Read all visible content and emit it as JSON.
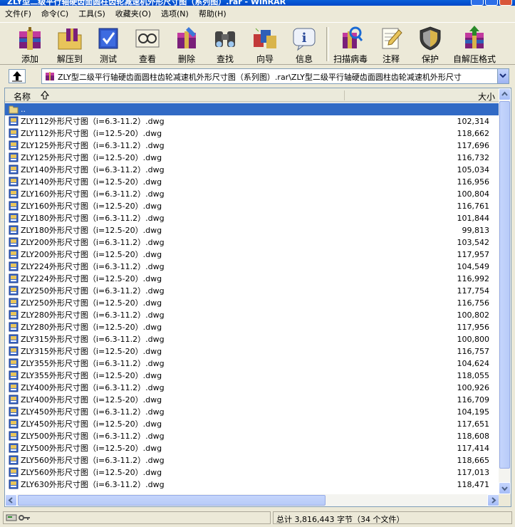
{
  "window": {
    "title": "ZLY型二级平行轴硬齿面圆柱齿轮减速机外形尺寸图（系列图）.rar - WinRAR"
  },
  "menu": [
    "文件(F)",
    "命令(C)",
    "工具(S)",
    "收藏夹(O)",
    "选项(N)",
    "帮助(H)"
  ],
  "toolbar": [
    {
      "label": "添加",
      "icon": "add-archive-icon"
    },
    {
      "label": "解压到",
      "icon": "extract-to-icon"
    },
    {
      "label": "测试",
      "icon": "test-icon"
    },
    {
      "label": "查看",
      "icon": "view-icon"
    },
    {
      "label": "删除",
      "icon": "delete-icon"
    },
    {
      "label": "查找",
      "icon": "find-icon"
    },
    {
      "label": "向导",
      "icon": "wizard-icon"
    },
    {
      "label": "信息",
      "icon": "info-icon"
    },
    {
      "label": "扫描病毒",
      "icon": "virus-scan-icon"
    },
    {
      "label": "注释",
      "icon": "comment-icon"
    },
    {
      "label": "保护",
      "icon": "protect-icon"
    },
    {
      "label": "自解压格式",
      "icon": "sfx-icon"
    }
  ],
  "address": {
    "path": "ZLY型二级平行轴硬齿面圆柱齿轮减速机外形尺寸图（系列图）.rar\\ZLY型二级平行轴硬齿面圆柱齿轮减速机外形尺寸"
  },
  "columns": {
    "name": "名称",
    "size": "大小"
  },
  "parent_row": "..",
  "files": [
    {
      "name": "ZLY112外形尺寸图（i=6.3-11.2）.dwg",
      "size": "102,314"
    },
    {
      "name": "ZLY112外形尺寸图（i=12.5-20）.dwg",
      "size": "118,662"
    },
    {
      "name": "ZLY125外形尺寸图（i=6.3-11.2）.dwg",
      "size": "117,696"
    },
    {
      "name": "ZLY125外形尺寸图（i=12.5-20）.dwg",
      "size": "116,732"
    },
    {
      "name": "ZLY140外形尺寸图（i=6.3-11.2）.dwg",
      "size": "105,034"
    },
    {
      "name": "ZLY140外形尺寸图（i=12.5-20）.dwg",
      "size": "116,956"
    },
    {
      "name": "ZLY160外形尺寸图（i=6.3-11.2）.dwg",
      "size": "100,804"
    },
    {
      "name": "ZLY160外形尺寸图（i=12.5-20）.dwg",
      "size": "116,761"
    },
    {
      "name": "ZLY180外形尺寸图（i=6.3-11.2）.dwg",
      "size": "101,844"
    },
    {
      "name": "ZLY180外形尺寸图（i=12.5-20）.dwg",
      "size": "99,813"
    },
    {
      "name": "ZLY200外形尺寸图（i=6.3-11.2）.dwg",
      "size": "103,542"
    },
    {
      "name": "ZLY200外形尺寸图（i=12.5-20）.dwg",
      "size": "117,957"
    },
    {
      "name": "ZLY224外形尺寸图（i=6.3-11.2）.dwg",
      "size": "104,549"
    },
    {
      "name": "ZLY224外形尺寸图（i=12.5-20）.dwg",
      "size": "116,992"
    },
    {
      "name": "ZLY250外形尺寸图（i=6.3-11.2）.dwg",
      "size": "117,754"
    },
    {
      "name": "ZLY250外形尺寸图（i=12.5-20）.dwg",
      "size": "116,756"
    },
    {
      "name": "ZLY280外形尺寸图（i=6.3-11.2）.dwg",
      "size": "100,802"
    },
    {
      "name": "ZLY280外形尺寸图（i=12.5-20）.dwg",
      "size": "117,956"
    },
    {
      "name": "ZLY315外形尺寸图（i=6.3-11.2）.dwg",
      "size": "100,800"
    },
    {
      "name": "ZLY315外形尺寸图（i=12.5-20）.dwg",
      "size": "116,757"
    },
    {
      "name": "ZLY355外形尺寸图（i=6.3-11.2）.dwg",
      "size": "104,624"
    },
    {
      "name": "ZLY355外形尺寸图（i=12.5-20）.dwg",
      "size": "118,055"
    },
    {
      "name": "ZLY400外形尺寸图（i=6.3-11.2）.dwg",
      "size": "100,926"
    },
    {
      "name": "ZLY400外形尺寸图（i=12.5-20）.dwg",
      "size": "116,709"
    },
    {
      "name": "ZLY450外形尺寸图（i=6.3-11.2）.dwg",
      "size": "104,195"
    },
    {
      "name": "ZLY450外形尺寸图（i=12.5-20）.dwg",
      "size": "117,651"
    },
    {
      "name": "ZLY500外形尺寸图（i=6.3-11.2）.dwg",
      "size": "118,608"
    },
    {
      "name": "ZLY500外形尺寸图（i=12.5-20）.dwg",
      "size": "117,414"
    },
    {
      "name": "ZLY560外形尺寸图（i=6.3-11.2）.dwg",
      "size": "118,665"
    },
    {
      "name": "ZLY560外形尺寸图（i=12.5-20）.dwg",
      "size": "117,013"
    },
    {
      "name": "ZLY630外形尺寸图（i=6.3-11.2）.dwg",
      "size": "118,471"
    }
  ],
  "status": {
    "summary": "总计 3,816,443 字节（34 个文件）"
  },
  "colors": {
    "selection": "#316ac5",
    "titlebar": "#0a5fd8",
    "chrome": "#ece9d8"
  }
}
